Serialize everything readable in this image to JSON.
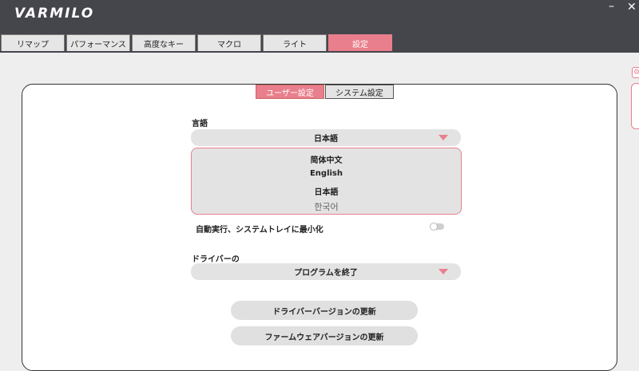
{
  "app": {
    "logo_text": "VARMILO",
    "minimize": "–",
    "close": "✕"
  },
  "tabs": [
    {
      "label": "リマップ"
    },
    {
      "label": "パフォーマンス"
    },
    {
      "label": "高度なキー"
    },
    {
      "label": "マクロ"
    },
    {
      "label": "ライト"
    },
    {
      "label": "設定",
      "active": true
    }
  ],
  "subtabs": [
    {
      "label": "ユーザー設定",
      "active": true
    },
    {
      "label": "システム設定"
    }
  ],
  "language": {
    "label": "言語",
    "selected": "日本語",
    "options": [
      "简体中文",
      "English",
      "日本語",
      "한국어"
    ]
  },
  "autostart": {
    "label": "自動実行、システムトレイに最小化",
    "enabled": false
  },
  "driver": {
    "label": "ドライバーの",
    "selected": "プログラムを終了"
  },
  "buttons": {
    "update_driver": "ドライバーバージョンの更新",
    "update_firmware": "ファームウェアバージョンの更新"
  },
  "colors": {
    "accent": "#e97f8c",
    "titlebar": "#45464c"
  },
  "icons": {
    "side_gear": "⚙"
  }
}
